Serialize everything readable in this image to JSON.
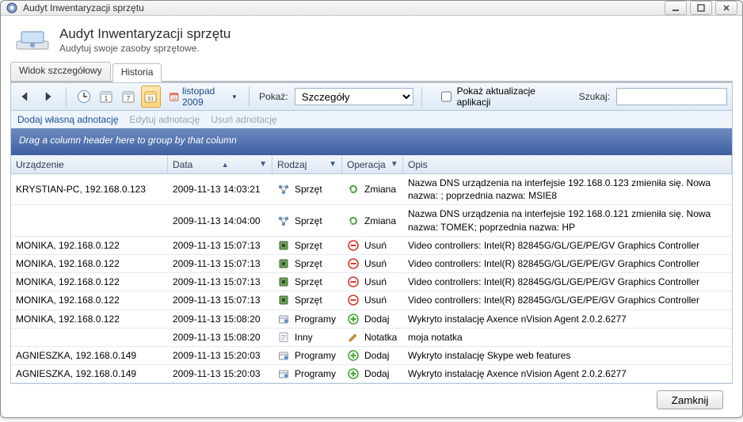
{
  "window": {
    "title": "Audyt Inwentaryzacji sprzętu"
  },
  "header": {
    "title": "Audyt Inwentaryzacji sprzętu",
    "subtitle": "Audytuj swoje zasoby sprzętowe."
  },
  "tabs": {
    "items": [
      {
        "label": "Widok szczegółowy",
        "active": false
      },
      {
        "label": "Historia",
        "active": true
      }
    ]
  },
  "toolbar": {
    "period_label": "listopad 2009",
    "show_label": "Pokaż:",
    "show_select_value": "Szczegóły",
    "checkbox_label": "Pokaż aktualizacje aplikacji",
    "checkbox_checked": false,
    "search_label": "Szukaj:",
    "search_value": ""
  },
  "subtoolbar": {
    "add_annotation": "Dodaj własną adnotację",
    "edit_annotation": "Edytuj adnotację",
    "delete_annotation": "Usuń adnotację"
  },
  "grouping_hint": "Drag a column header here to group by that column",
  "columns": {
    "device": "Urządzenie",
    "date": "Data",
    "kind": "Rodzaj",
    "operation": "Operacja",
    "description": "Opis"
  },
  "rows": [
    {
      "device": "KRYSTIAN-PC, 192.168.0.123",
      "date": "2009-11-13 14:03:21",
      "kind_icon": "nodes-icon",
      "kind": "Sprzęt",
      "op_icon": "refresh-icon",
      "op_color": "#4aa53a",
      "operation": "Zmiana",
      "description": "Nazwa DNS urządzenia na interfejsie 192.168.0.123 zmieniła się. Nowa nazwa:                      ; poprzednia nazwa: MSIE8",
      "tall": true
    },
    {
      "device": "",
      "date": "2009-11-13 14:04:00",
      "kind_icon": "nodes-icon",
      "kind": "Sprzęt",
      "op_icon": "refresh-icon",
      "op_color": "#4aa53a",
      "operation": "Zmiana",
      "description": "Nazwa DNS urządzenia na interfejsie 192.168.0.121 zmieniła się. Nowa nazwa: TOMEK; poprzednia nazwa: HP",
      "tall": true
    },
    {
      "device": "MONIKA, 192.168.0.122",
      "date": "2009-11-13 15:07:13",
      "kind_icon": "chip-icon",
      "kind": "Sprzęt",
      "op_icon": "minus-icon",
      "op_color": "#d33b2f",
      "operation": "Usuń",
      "description": "Video controllers: Intel(R) 82845G/GL/GE/PE/GV Graphics Controller"
    },
    {
      "device": "MONIKA, 192.168.0.122",
      "date": "2009-11-13 15:07:13",
      "kind_icon": "chip-icon",
      "kind": "Sprzęt",
      "op_icon": "minus-icon",
      "op_color": "#d33b2f",
      "operation": "Usuń",
      "description": "Video controllers: Intel(R) 82845G/GL/GE/PE/GV Graphics Controller"
    },
    {
      "device": "MONIKA, 192.168.0.122",
      "date": "2009-11-13 15:07:13",
      "kind_icon": "chip-icon",
      "kind": "Sprzęt",
      "op_icon": "minus-icon",
      "op_color": "#d33b2f",
      "operation": "Usuń",
      "description": "Video controllers: Intel(R) 82845G/GL/GE/PE/GV Graphics Controller"
    },
    {
      "device": "MONIKA, 192.168.0.122",
      "date": "2009-11-13 15:07:13",
      "kind_icon": "chip-icon",
      "kind": "Sprzęt",
      "op_icon": "minus-icon",
      "op_color": "#d33b2f",
      "operation": "Usuń",
      "description": "Video controllers: Intel(R) 82845G/GL/GE/PE/GV Graphics Controller"
    },
    {
      "device": "MONIKA, 192.168.0.122",
      "date": "2009-11-13 15:08:20",
      "kind_icon": "package-icon",
      "kind": "Programy",
      "op_icon": "plus-icon",
      "op_color": "#4aa53a",
      "operation": "Dodaj",
      "description": "Wykryto instalację Axence nVision Agent 2.0.2.6277"
    },
    {
      "device": "",
      "date": "2009-11-13 15:08:20",
      "kind_icon": "note-icon",
      "kind": "Inny",
      "op_icon": "pencil-icon",
      "op_color": "#c79a2d",
      "operation": "Notatka",
      "description": "moja notatka"
    },
    {
      "device": "AGNIESZKA, 192.168.0.149",
      "date": "2009-11-13 15:20:03",
      "kind_icon": "package-icon",
      "kind": "Programy",
      "op_icon": "plus-icon",
      "op_color": "#4aa53a",
      "operation": "Dodaj",
      "description": "Wykryto instalację Skype web features"
    },
    {
      "device": "AGNIESZKA, 192.168.0.149",
      "date": "2009-11-13 15:20:03",
      "kind_icon": "package-icon",
      "kind": "Programy",
      "op_icon": "plus-icon",
      "op_color": "#4aa53a",
      "operation": "Dodaj",
      "description": "Wykryto instalację Axence nVision Agent 2.0.2.6277"
    }
  ],
  "footer": {
    "close_label": "Zamknij"
  }
}
